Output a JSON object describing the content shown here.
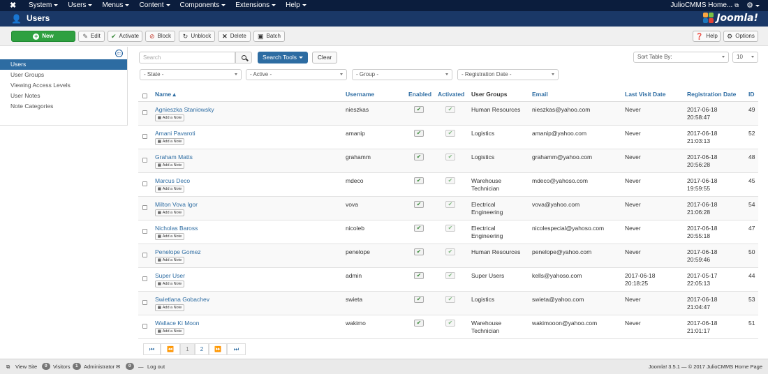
{
  "topnav": {
    "menu": [
      "System",
      "Users",
      "Menus",
      "Content",
      "Components",
      "Extensions",
      "Help"
    ],
    "site_name": "JulioCMMS Home...",
    "icons": {
      "logo": "joomla-logo-icon",
      "external": "external-link-icon",
      "settings": "gear-icon"
    }
  },
  "titlebar": {
    "title": "Users",
    "brand": "Joomla!",
    "brand_colors": [
      "#f9a541",
      "#7ac143",
      "#1c76bb",
      "#e44134"
    ]
  },
  "toolbar": {
    "new": "New",
    "edit": "Edit",
    "activate": "Activate",
    "block": "Block",
    "unblock": "Unblock",
    "delete": "Delete",
    "batch": "Batch",
    "help": "Help",
    "options": "Options"
  },
  "sidebar": {
    "items": [
      "Users",
      "User Groups",
      "Viewing Access Levels",
      "User Notes",
      "Note Categories"
    ],
    "active_index": 0
  },
  "filters": {
    "search_placeholder": "Search",
    "search_tools": "Search Tools",
    "clear": "Clear",
    "sort_by": "Sort Table By:",
    "limit": "10",
    "state": "- State -",
    "active": "- Active -",
    "group": "- Group -",
    "registration_date": "- Registration Date -"
  },
  "table": {
    "headers": {
      "name": "Name",
      "username": "Username",
      "enabled": "Enabled",
      "activated": "Activated",
      "user_groups": "User Groups",
      "email": "Email",
      "last_visit": "Last Visit Date",
      "registration": "Registration Date",
      "id": "ID"
    },
    "add_note": "Add a Note",
    "rows": [
      {
        "name": "Agnieszka Staniowsky",
        "username": "nieszkas",
        "groups": [
          "Human Resources"
        ],
        "email": "nieszkas@yahoo.com",
        "last_visit": [
          "Never"
        ],
        "registered": [
          "2017-06-18",
          "20:58:47"
        ],
        "id": "49"
      },
      {
        "name": "Amani Pavaroti",
        "username": "amanip",
        "groups": [
          "Logistics"
        ],
        "email": "amanip@yahoo.com",
        "last_visit": [
          "Never"
        ],
        "registered": [
          "2017-06-18",
          "21:03:13"
        ],
        "id": "52"
      },
      {
        "name": "Graham Matts",
        "username": "grahamm",
        "groups": [
          "Logistics"
        ],
        "email": "grahamm@yahoo.com",
        "last_visit": [
          "Never"
        ],
        "registered": [
          "2017-06-18",
          "20:56:28"
        ],
        "id": "48"
      },
      {
        "name": "Marcus Deco",
        "username": "mdeco",
        "groups": [
          "Warehouse",
          "Technician"
        ],
        "email": "mdeco@yahoso.com",
        "last_visit": [
          "Never"
        ],
        "registered": [
          "2017-06-18",
          "19:59:55"
        ],
        "id": "45"
      },
      {
        "name": "Milton Vova Igor",
        "username": "vova",
        "groups": [
          "Electrical",
          "Engineering"
        ],
        "email": "vova@yahoo.com",
        "last_visit": [
          "Never"
        ],
        "registered": [
          "2017-06-18",
          "21:06:28"
        ],
        "id": "54"
      },
      {
        "name": "Nicholas Baross",
        "username": "nicoleb",
        "groups": [
          "Electrical",
          "Engineering"
        ],
        "email": "nicolespecial@yahoso.com",
        "last_visit": [
          "Never"
        ],
        "registered": [
          "2017-06-18",
          "20:55:18"
        ],
        "id": "47"
      },
      {
        "name": "Penelope Gomez",
        "username": "penelope",
        "groups": [
          "Human Resources"
        ],
        "email": "penelope@yahoo.com",
        "last_visit": [
          "Never"
        ],
        "registered": [
          "2017-06-18",
          "20:59:46"
        ],
        "id": "50"
      },
      {
        "name": "Super User",
        "username": "admin",
        "groups": [
          "Super Users"
        ],
        "email": "kells@yahoso.com",
        "last_visit": [
          "2017-06-18",
          "20:18:25"
        ],
        "registered": [
          "2017-05-17",
          "22:05:13"
        ],
        "id": "44"
      },
      {
        "name": "Swietlana Gobachev",
        "username": "swieta",
        "groups": [
          "Logistics"
        ],
        "email": "swieta@yahoo.com",
        "last_visit": [
          "Never"
        ],
        "registered": [
          "2017-06-18",
          "21:04:47"
        ],
        "id": "53"
      },
      {
        "name": "Wallace Ki Moon",
        "username": "wakimo",
        "groups": [
          "Warehouse",
          "Technician"
        ],
        "email": "wakimooon@yahoo.com",
        "last_visit": [
          "Never"
        ],
        "registered": [
          "2017-06-18",
          "21:01:17"
        ],
        "id": "51"
      }
    ]
  },
  "pagination": {
    "pages": [
      "1",
      "2"
    ],
    "current": "1"
  },
  "statusbar": {
    "view_site": "View Site",
    "visitors_count": "0",
    "visitors": "Visitors",
    "admin_count": "1",
    "administrator": "Administrator",
    "messages_count": "0",
    "logout": "Log out",
    "version": "Joomla! 3.5.1 — © 2017 JulioCMMS Home Page"
  }
}
